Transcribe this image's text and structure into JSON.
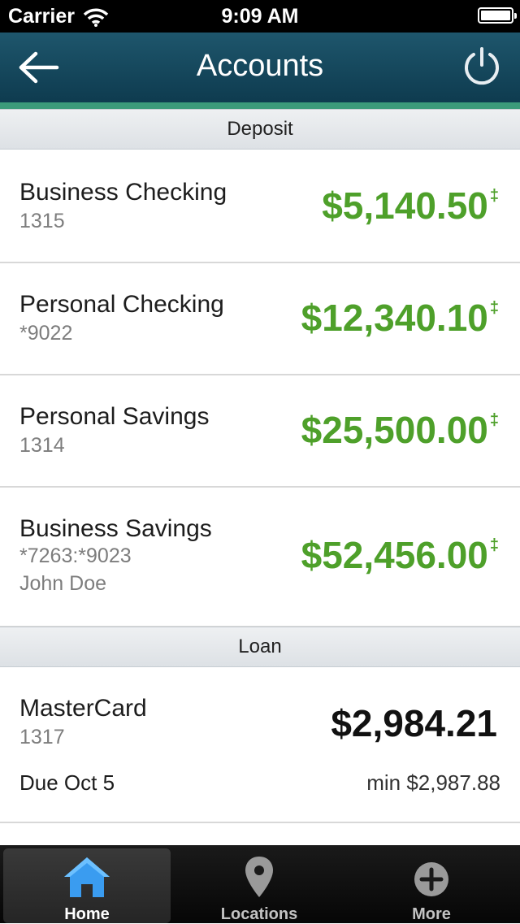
{
  "status_bar": {
    "carrier": "Carrier",
    "time": "9:09 AM"
  },
  "nav": {
    "title": "Accounts",
    "back_icon": "back-arrow-icon",
    "power_icon": "power-icon"
  },
  "sections": {
    "deposit": "Deposit",
    "loan": "Loan"
  },
  "deposit_accounts": [
    {
      "name": "Business Checking",
      "number": "1315",
      "balance": "$5,140.50",
      "mark": "‡"
    },
    {
      "name": "Personal Checking",
      "number": "*9022",
      "balance": "$12,340.10",
      "mark": "‡"
    },
    {
      "name": "Personal Savings",
      "number": "1314",
      "balance": "$25,500.00",
      "mark": "‡"
    },
    {
      "name": "Business Savings",
      "number": "*7263:*9023",
      "owner": "John Doe",
      "balance": "$52,456.00",
      "mark": "‡"
    }
  ],
  "loan_accounts": [
    {
      "name": "MasterCard",
      "number": "1317",
      "balance": "$2,984.21",
      "due": "Due Oct 5",
      "min": "min $2,987.88"
    }
  ],
  "tabs": [
    {
      "label": "Home",
      "icon": "home-icon",
      "active": true
    },
    {
      "label": "Locations",
      "icon": "location-pin-icon",
      "active": false
    },
    {
      "label": "More",
      "icon": "plus-circle-icon",
      "active": false
    }
  ],
  "colors": {
    "nav_bg": "#0e3b4f",
    "nav_accent": "#3b9a7a",
    "positive_amount": "#4ea02a",
    "home_icon": "#3a9cf0"
  }
}
